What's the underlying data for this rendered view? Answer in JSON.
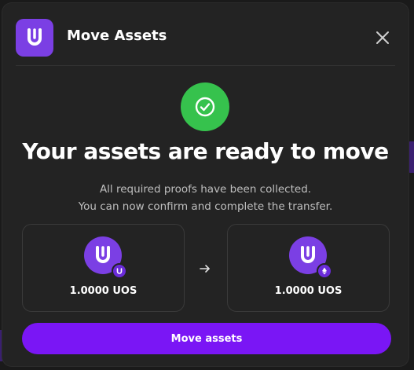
{
  "dialog": {
    "title": "Move Assets",
    "close_icon": "close-icon",
    "logo_icon": "ultra-logo-icon"
  },
  "status": {
    "icon": "check-circle-icon",
    "headline": "Your assets are ready to move",
    "description_line1": "All required proofs have been collected.",
    "description_line2": "You can now confirm and complete the transfer."
  },
  "transfer": {
    "from": {
      "amount": "1.0000 UOS",
      "token_icon": "uos-token-icon",
      "network_icon": "ultra-network-badge-icon"
    },
    "arrow_icon": "arrow-right-icon",
    "to": {
      "amount": "1.0000 UOS",
      "token_icon": "uos-token-icon",
      "network_icon": "ethereum-network-badge-icon"
    }
  },
  "actions": {
    "primary_label": "Move assets"
  },
  "colors": {
    "accent": "#7a16f5",
    "brand": "#7b3fe4",
    "success": "#36c24d",
    "modal_bg": "#232323"
  }
}
